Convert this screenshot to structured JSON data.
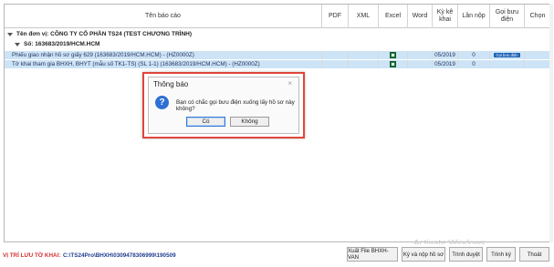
{
  "columns": [
    "Tên báo cáo",
    "PDF",
    "XML",
    "Excel",
    "Word",
    "Kỳ kê khai",
    "Lần nộp",
    "Gọi bưu điện",
    "Chọn"
  ],
  "group1": {
    "label": "Tên đơn vị: CÔNG TY CỔ PHẦN TS24 (TEST CHƯƠNG TRÌNH)"
  },
  "group2": {
    "label": "Số: 163683/2019/HCM.HCM"
  },
  "rows": [
    {
      "name": "Phiếu giao nhận hồ sơ giấy 629 (163683/2019/HCM.HCM) - (HZ0000Z)",
      "period": "05/2019",
      "times": "0",
      "post": "Gọi bưu điện"
    },
    {
      "name": "Tờ khai tham gia BHXH, BHYT (mẫu số TK1-TS) (SL 1-1) (163683/2019/HCM.HCM) - (HZ0000Z)",
      "period": "05/2019",
      "times": "0",
      "post": ""
    }
  ],
  "dialog": {
    "title": "Thông báo",
    "close": "×",
    "icon": "question-icon",
    "icon_glyph": "?",
    "message": "Bạn có chắc gọi bưu điện xuống lấy hồ sơ này không?",
    "yes": "Có",
    "no": "Không"
  },
  "footer": {
    "location_label": "VỊ TRÍ LƯU TỜ KHAI:",
    "location_path": "C:\\TS24Pro\\BHXH\\0309478306999\\190509",
    "buttons": [
      "Xuất File BHXH-VAN",
      "Ký và nộp hồ sơ",
      "Trình duyệt",
      "Trình ký",
      "Thoát"
    ]
  },
  "watermark": "Activate Windows",
  "colors": {
    "selected_row": "#cde4f6",
    "dialog_border": "#e0453a",
    "location_label": "#d32f2f",
    "location_path": "#1e3d8f",
    "post_badge": "#1a5fb4"
  }
}
